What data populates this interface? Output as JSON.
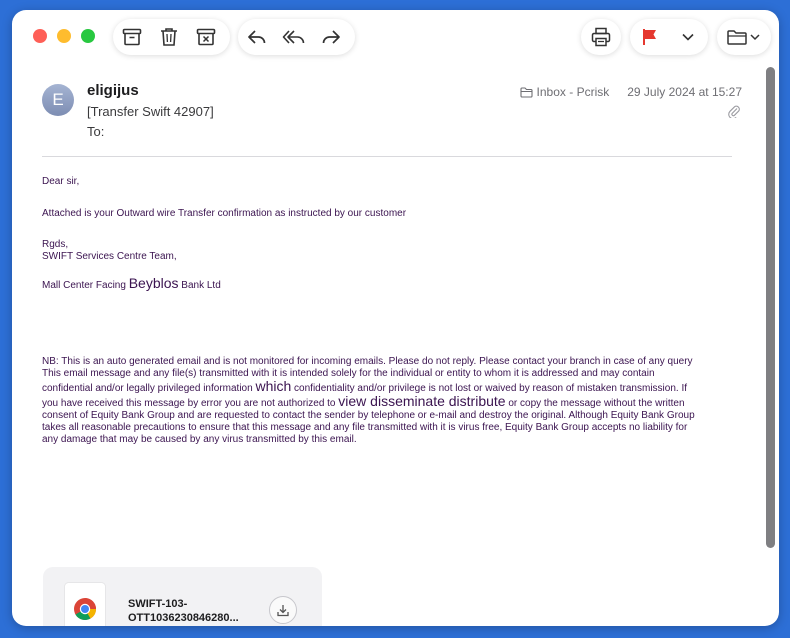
{
  "toolbar": {
    "buttons": [
      "archive-icon",
      "trash-icon",
      "junk-icon",
      "reply-icon",
      "reply-all-icon",
      "forward-icon",
      "print-icon",
      "flag-icon",
      "chevron-down-icon",
      "move-folder-icon"
    ],
    "flag_color": "#e5382f"
  },
  "email": {
    "avatar_initial": "E",
    "sender": "eligijus",
    "subject": "[Transfer Swift 42907]",
    "to_label": "To:",
    "mailbox": "Inbox - Pcrisk",
    "date": "29 July 2024 at 15:27"
  },
  "body": {
    "greeting": "Dear sir,",
    "line1": "Attached is your Outward wire Transfer confirmation as instructed by our customer",
    "sign1": "Rgds,",
    "sign2": "SWIFT Services Centre Team,",
    "bank_pre": "Mall Center Facing ",
    "bank_big": "Beyblos",
    "bank_post": " Bank Ltd",
    "nb1": "NB: This is an auto generated email and is not monitored for incoming emails. Please do not reply. Please contact your branch in case of any query",
    "nb2": "This email message and any file(s) transmitted with it is intended solely for the individual or entity to whom it is addressed and may contain",
    "nb3a": "confidential and/or legally privileged information ",
    "nb3b": "which",
    "nb3c": " confidentiality and/or privilege is not lost or waived by reason of mistaken transmission. If",
    "nb4a": "you have received this message by error you are not authorized to ",
    "nb4b": "view disseminate distribute",
    "nb4c": " or copy the message without the written",
    "nb5": "consent of Equity Bank Group and are requested to contact the sender by telephone or e-mail and destroy the original. Although Equity Bank Group",
    "nb6": "takes all reasonable precautions to ensure that this message and any file transmitted with it is virus free, Equity Bank Group accepts no liability for",
    "nb7": "any damage that may be caused by any virus transmitted by this email."
  },
  "attachment": {
    "name_line1": "SWIFT-103-",
    "name_line2": "OTT1036230846280...",
    "icon": "chrome-icon"
  }
}
